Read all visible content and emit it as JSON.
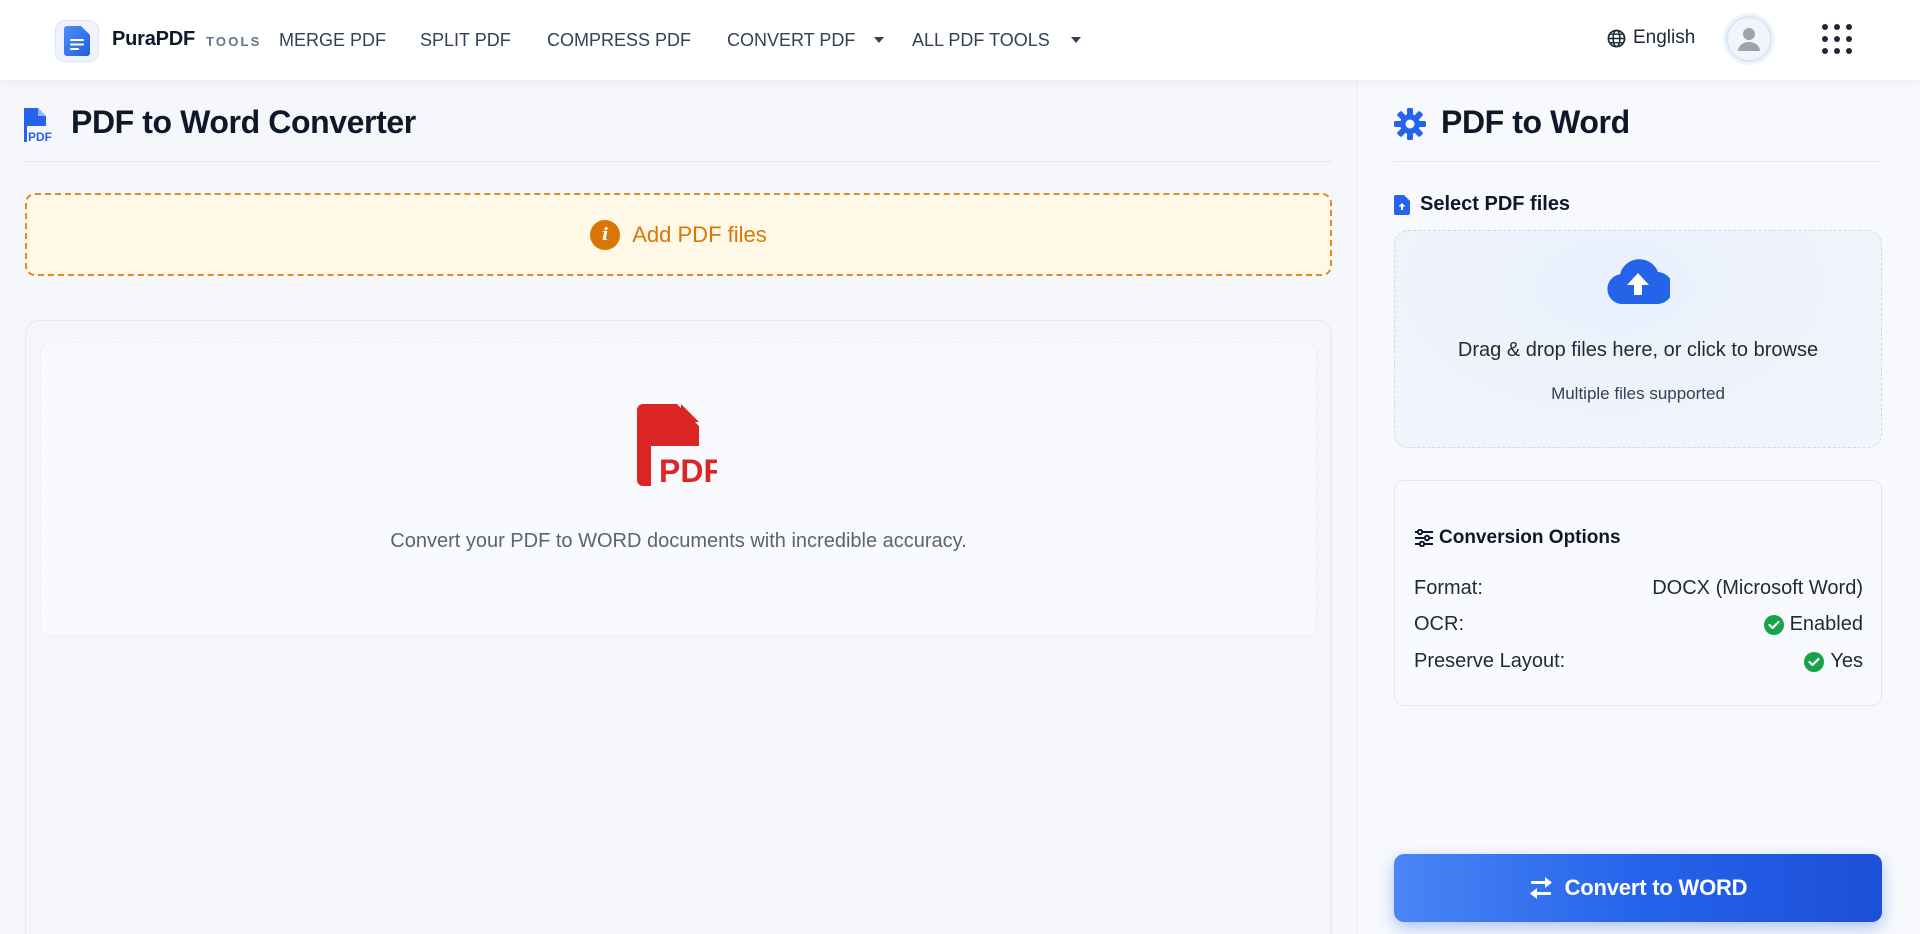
{
  "header": {
    "brand": "PuraPDF",
    "brand_sub": "TOOLS",
    "nav": [
      {
        "label": "MERGE PDF"
      },
      {
        "label": "SPLIT PDF"
      },
      {
        "label": "COMPRESS PDF"
      },
      {
        "label": "CONVERT PDF",
        "dropdown": true
      },
      {
        "label": "ALL PDF TOOLS",
        "dropdown": true
      }
    ],
    "language": "English",
    "icons": {
      "logo": "document-icon",
      "language": "globe-icon",
      "avatar": "user-icon",
      "apps": "grid-dots-icon"
    }
  },
  "main": {
    "title": "PDF to Word Converter",
    "add_banner": "Add PDF files",
    "empty_state_text": "Convert your PDF to WORD documents with incredible accuracy."
  },
  "sidebar": {
    "title": "PDF to Word",
    "select_label": "Select PDF files",
    "dropzone": {
      "text": "Drag & drop files here, or click to browse",
      "subtext": "Multiple files supported"
    },
    "options": {
      "heading": "Conversion Options",
      "rows": [
        {
          "label": "Format:",
          "value": "DOCX (Microsoft Word)"
        },
        {
          "label": "OCR:",
          "value": "Enabled",
          "check": true
        },
        {
          "label": "Preserve Layout:",
          "value": "Yes",
          "check": true
        }
      ]
    },
    "convert_button": "Convert to WORD"
  },
  "colors": {
    "accent": "#2563eb",
    "warning": "#d97706",
    "pdf_red": "#dc2626",
    "success": "#16a34a"
  }
}
